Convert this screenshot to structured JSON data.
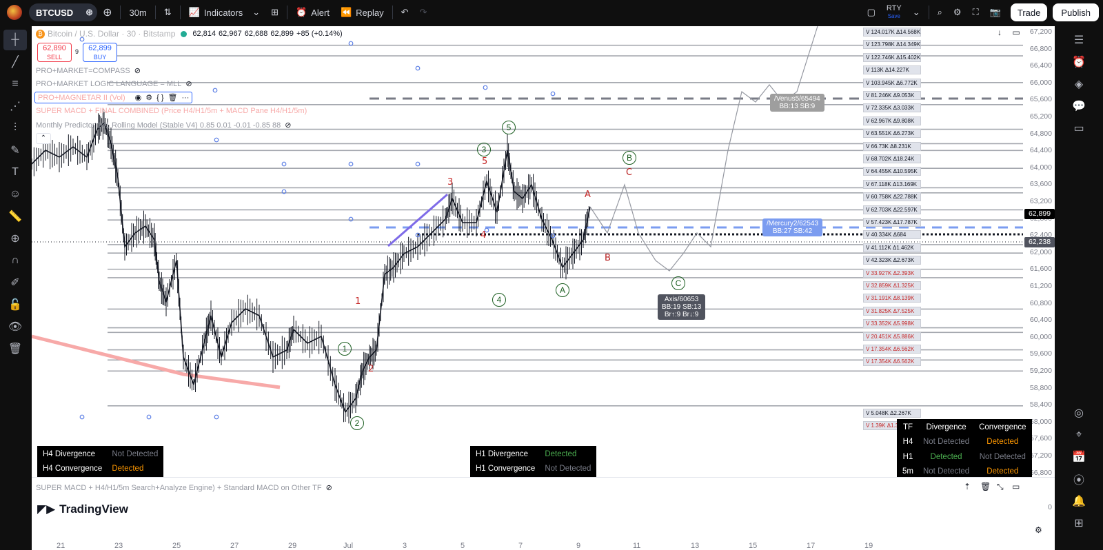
{
  "topbar": {
    "symbol": "BTCUSD",
    "interval": "30m",
    "indicators": "Indicators",
    "alert": "Alert",
    "replay": "Replay",
    "layout_name": "RTY",
    "layout_sub": "Save",
    "trade": "Trade",
    "publish": "Publish"
  },
  "header": {
    "title": "Bitcoin / U.S. Dollar · 30 · Bitstamp",
    "o": "62,814",
    "h": "62,967",
    "l": "62,688",
    "c": "62,899",
    "chg": "+85 (+0.14%)"
  },
  "trade": {
    "sell_price": "62,890",
    "sell_label": "SELL",
    "spread": "9",
    "buy_price": "62,899",
    "buy_label": "BUY"
  },
  "legends": {
    "l1": "PRO+MARKET=COMPASS",
    "l2": "PRO+MARKET LOGIC LANGUAGE = MLL",
    "l3": "PRO+MAGNETAR II (Vol)",
    "l4": "SUPER MACD + FINAL COMBINED (Price H4/H1/5m + MACD Pane H4/H1/5m)",
    "l5": "Monthly Predictor 101 Rolling Model (Stable V4) 0.85 0.01 -0.01 -0.85 88"
  },
  "price_axis": [
    "67,200",
    "66,800",
    "66,400",
    "66,000",
    "65,600",
    "65,200",
    "64,800",
    "64,400",
    "64,000",
    "63,600",
    "63,200",
    "62,800",
    "62,400",
    "62,000",
    "61,600",
    "61,200",
    "60,800",
    "60,400",
    "60,000",
    "59,600",
    "59,200",
    "58,800",
    "58,400",
    "58,000",
    "57,600",
    "57,200",
    "56,800"
  ],
  "price_tags": {
    "last": "62,899",
    "line": "62,238"
  },
  "vol_boxes": [
    "V 124.017K  Δ14.568K",
    "V 123.798K  Δ14.349K",
    "V 122.746K  Δ15.402K",
    "V 113K  Δ14.227K",
    "V 103.945K  Δ6.772K",
    "V 81.246K  Δ9.053K",
    "V 72.335K  Δ3.033K",
    "V 62.967K  Δ9.808K",
    "V 63.551K  Δ6.273K",
    "V 66.73K  Δ8.231K",
    "V 68.702K  Δ18.24K",
    "V 64.455K  Δ10.595K",
    "V 67.118K  Δ13.169K",
    "V 60.758K  Δ22.788K",
    "V 62.703K  Δ22.597K",
    "V 57.423K  Δ17.787K",
    "V 40.334K  Δ684",
    "V 41.112K  Δ1.462K",
    "V 42.323K  Δ2.673K",
    "V 33.927K  Δ2.393K",
    "V 32.859K  Δ1.325K",
    "V 31.191K  Δ8.139K",
    "V 31.825K  Δ7.525K",
    "V 33.352K  Δ5.998K",
    "V 20.451K  Δ5.886K",
    "V 17.354K  Δ6.562K",
    "V 17.354K  Δ6.562K",
    "V 5.048K  Δ2.267K",
    "V 1.39K  Δ1.39K"
  ],
  "tags": {
    "venus": [
      "/Venus5/65494",
      "BB:13  SB:9"
    ],
    "mercury": [
      "/Mercury2/62543",
      "BB:27  SB:42"
    ],
    "axis": [
      "Axis/60653",
      "BB:19  SB:13",
      "Br↑:9  Br↓:9"
    ]
  },
  "waves": {
    "w1": "1",
    "w2": "2",
    "w3": "3",
    "w4": "4",
    "w5": "5",
    "wA": "A",
    "wB": "B",
    "wC": "C",
    "cr1": "1",
    "cr2": "2",
    "cr3": "3",
    "cr4": "4",
    "cr5": "5",
    "crA": "A",
    "crB": "B",
    "crC": "C"
  },
  "tables": {
    "h4": [
      [
        "H4 Divergence",
        "Not Detected"
      ],
      [
        "H4 Convergence",
        "Detected"
      ]
    ],
    "h1": [
      [
        "H1 Divergence",
        "Detected"
      ],
      [
        "H1 Convergence",
        "Not Detected"
      ]
    ],
    "tf": [
      [
        "TF",
        "Divergence",
        "Convergence"
      ],
      [
        "H4",
        "Not Detected",
        "Detected"
      ],
      [
        "H1",
        "Detected",
        "Not Detected"
      ],
      [
        "5m",
        "Not Detected",
        "Detected"
      ]
    ]
  },
  "lower_pane": {
    "legend": "SUPER MACD + H4/H1/5m Search+Analyze Engine) + Standard MACD on Other TF",
    "brand": "TradingView",
    "zero": "0"
  },
  "date_axis": [
    "21",
    "23",
    "25",
    "27",
    "29",
    "Jul",
    "3",
    "5",
    "7",
    "9",
    "11",
    "13",
    "15",
    "17",
    "19"
  ],
  "colors": {
    "accent": "#2962ff",
    "sell": "#f23645",
    "buy": "#2962ff",
    "wave_red": "#b71c1c",
    "wave_green": "#1b5e20",
    "ema": "#f7a9a8"
  }
}
